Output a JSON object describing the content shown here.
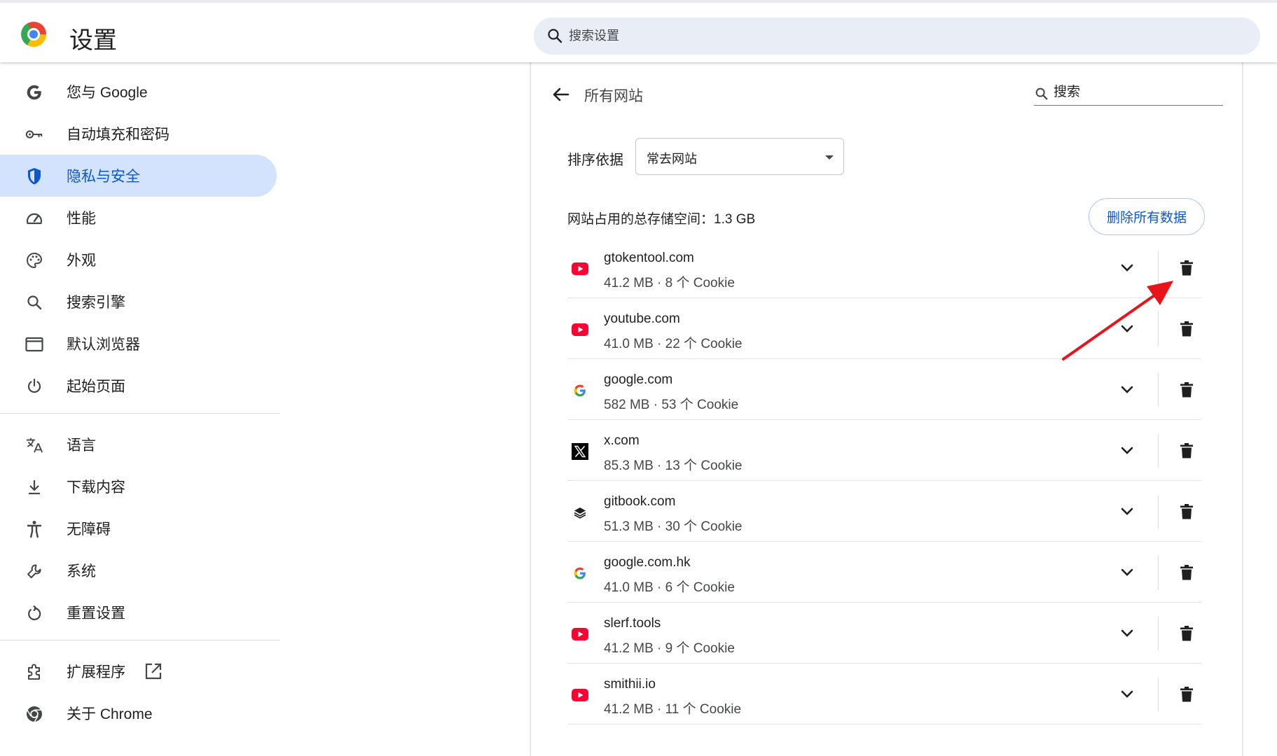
{
  "app": {
    "title": "设置"
  },
  "search": {
    "placeholder": "搜索设置"
  },
  "sidebar": {
    "items": [
      {
        "label": "您与 Google",
        "icon": "google-g-icon"
      },
      {
        "label": "自动填充和密码",
        "icon": "key-icon"
      },
      {
        "label": "隐私与安全",
        "icon": "shield-icon",
        "active": true
      },
      {
        "label": "性能",
        "icon": "speedometer-icon"
      },
      {
        "label": "外观",
        "icon": "palette-icon"
      },
      {
        "label": "搜索引擎",
        "icon": "search-icon"
      },
      {
        "label": "默认浏览器",
        "icon": "browser-window-icon"
      },
      {
        "label": "起始页面",
        "icon": "power-icon"
      },
      {
        "label": "语言",
        "icon": "translate-icon"
      },
      {
        "label": "下载内容",
        "icon": "download-icon"
      },
      {
        "label": "无障碍",
        "icon": "accessibility-icon"
      },
      {
        "label": "系统",
        "icon": "wrench-icon"
      },
      {
        "label": "重置设置",
        "icon": "reset-icon"
      },
      {
        "label": "扩展程序",
        "icon": "puzzle-icon"
      },
      {
        "label": "关于 Chrome",
        "icon": "chrome-icon"
      }
    ]
  },
  "main": {
    "title": "所有网站",
    "search_placeholder": "搜索",
    "sort_label": "排序依据",
    "sort_value": "常去网站",
    "storage_label": "网站占用的总存储空间：1.3 GB",
    "clear_all_label": "删除所有数据",
    "sites": [
      {
        "name": "gtokentool.com",
        "info": "41.2 MB · 8 个 Cookie",
        "icon": "youtube-icon"
      },
      {
        "name": "youtube.com",
        "info": "41.0 MB · 22 个 Cookie",
        "icon": "youtube-icon"
      },
      {
        "name": "google.com",
        "info": "582 MB · 53 个 Cookie",
        "icon": "google-g-icon"
      },
      {
        "name": "x.com",
        "info": "85.3 MB · 13 个 Cookie",
        "icon": "x-logo-icon"
      },
      {
        "name": "gitbook.com",
        "info": "51.3 MB · 30 个 Cookie",
        "icon": "gitbook-icon"
      },
      {
        "name": "google.com.hk",
        "info": "41.0 MB · 6 个 Cookie",
        "icon": "google-g-icon"
      },
      {
        "name": "slerf.tools",
        "info": "41.2 MB · 9 个 Cookie",
        "icon": "youtube-icon"
      },
      {
        "name": "smithii.io",
        "info": "41.2 MB · 11 个 Cookie",
        "icon": "youtube-icon"
      }
    ]
  },
  "colors": {
    "accent": "#0b57d0",
    "active_bg": "#d3e3fd",
    "annotation": "#e8141b"
  }
}
